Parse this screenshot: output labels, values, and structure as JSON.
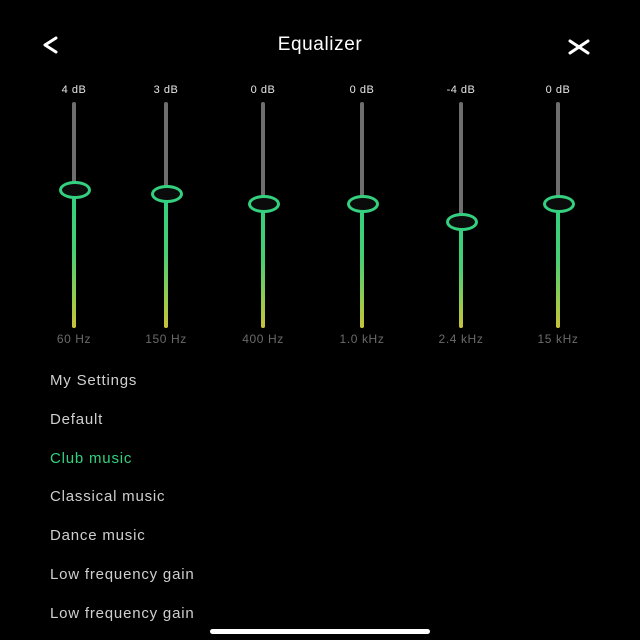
{
  "header": {
    "title": "Equalizer",
    "back_icon": "chevron-left-icon",
    "close_icon": "close-icon"
  },
  "bands": [
    {
      "gain_label": "4 dB",
      "gain_db": 4,
      "freq_label": "60 Hz"
    },
    {
      "gain_label": "3 dB",
      "gain_db": 3,
      "freq_label": "150 Hz"
    },
    {
      "gain_label": "0 dB",
      "gain_db": 0,
      "freq_label": "400 Hz"
    },
    {
      "gain_label": "0 dB",
      "gain_db": 0,
      "freq_label": "1.0 kHz"
    },
    {
      "gain_label": "-4 dB",
      "gain_db": -4,
      "freq_label": "2.4 kHz"
    },
    {
      "gain_label": "0 dB",
      "gain_db": 0,
      "freq_label": "15 kHz"
    }
  ],
  "presets": [
    {
      "label": "My Settings",
      "selected": false
    },
    {
      "label": "Default",
      "selected": false
    },
    {
      "label": "Club music",
      "selected": true
    },
    {
      "label": "Classical music",
      "selected": false
    },
    {
      "label": "Dance music",
      "selected": false
    },
    {
      "label": "Low frequency gain",
      "selected": false
    },
    {
      "label": "Low frequency gain",
      "selected": false
    }
  ],
  "colors": {
    "background": "#000000",
    "accent": "#34d07f",
    "track": "#6e6e6e",
    "preset_text": "#cfcfcf",
    "freq_text": "#6a6a6a"
  }
}
